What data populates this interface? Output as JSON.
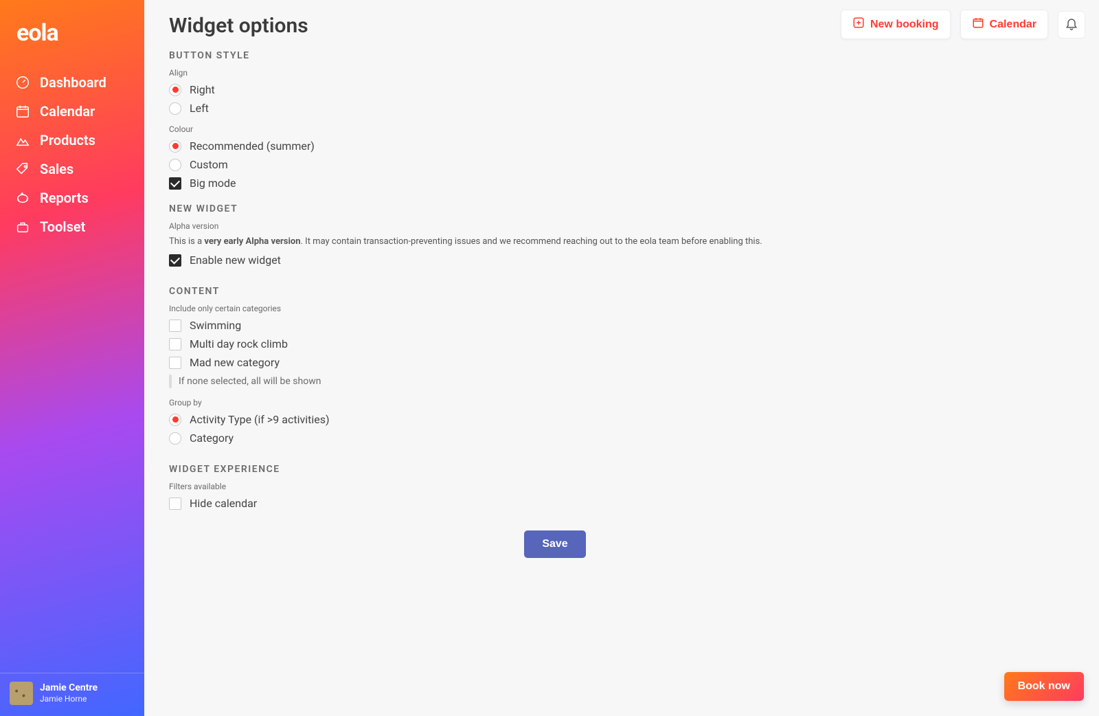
{
  "brand": "eola",
  "sidebar": {
    "items": [
      {
        "label": "Dashboard"
      },
      {
        "label": "Calendar"
      },
      {
        "label": "Products"
      },
      {
        "label": "Sales"
      },
      {
        "label": "Reports"
      },
      {
        "label": "Toolset"
      }
    ]
  },
  "profile": {
    "name": "Jamie Centre",
    "sub": "Jamie Horne"
  },
  "topbar": {
    "new_booking": "New booking",
    "calendar": "Calendar"
  },
  "page": {
    "title": "Widget options",
    "save": "Save",
    "book_now": "Book now"
  },
  "button_style": {
    "heading": "BUTTON STYLE",
    "align_label": "Align",
    "align_options": {
      "right": "Right",
      "left": "Left"
    },
    "align_selected": "right",
    "colour_label": "Colour",
    "colour_options": {
      "recommended": "Recommended (summer)",
      "custom": "Custom"
    },
    "colour_selected": "recommended",
    "big_mode_label": "Big mode",
    "big_mode_checked": true
  },
  "new_widget": {
    "heading": "NEW WIDGET",
    "sub_label": "Alpha version",
    "note_pre": "This is a ",
    "note_bold": "very early Alpha version",
    "note_post": ". It may contain transaction-preventing issues and we recommend reaching out to the eola team before enabling this.",
    "enable_label": "Enable new widget",
    "enable_checked": true
  },
  "content_section": {
    "heading": "CONTENT",
    "include_label": "Include only certain categories",
    "categories": [
      {
        "label": "Swimming",
        "checked": false
      },
      {
        "label": "Multi day rock climb",
        "checked": false
      },
      {
        "label": "Mad new category",
        "checked": false
      }
    ],
    "hint": "If none selected, all will be shown",
    "group_by_label": "Group by",
    "group_by_options": {
      "activity_type": "Activity Type (if >9 activities)",
      "category": "Category"
    },
    "group_by_selected": "activity_type"
  },
  "widget_experience": {
    "heading": "WIDGET EXPERIENCE",
    "filters_label": "Filters available",
    "hide_calendar_label": "Hide calendar",
    "hide_calendar_checked": false
  }
}
